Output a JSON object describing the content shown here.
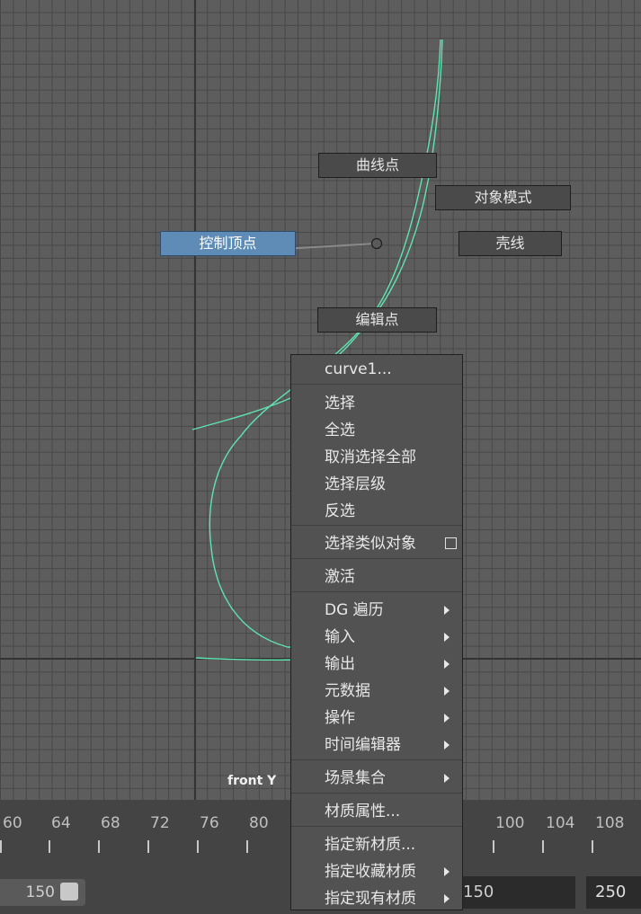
{
  "viewport": {
    "view_label": "front Y",
    "marking_menu": {
      "north": "曲线点",
      "northeast": "对象模式",
      "west": "控制顶点",
      "east": "壳线",
      "south": "编辑点"
    },
    "colors": {
      "background": "#5d5d5d",
      "grid": "#484848",
      "curve": "#5fe3b1",
      "active_item": "#5e8cb6"
    }
  },
  "timeline": {
    "ticks": [
      "60",
      "64",
      "68",
      "72",
      "76",
      "80",
      "100",
      "104",
      "108"
    ]
  },
  "range": {
    "end_value": "150",
    "end_field": "150",
    "max_field": "250"
  },
  "context_menu": {
    "title": "curve1...",
    "group1": [
      "选择",
      "全选",
      "取消选择全部",
      "选择层级",
      "反选"
    ],
    "select_similar": "选择类似对象",
    "activate": "激活",
    "submenus": [
      "DG 遍历",
      "输入",
      "输出",
      "元数据",
      "操作",
      "时间编辑器"
    ],
    "scene_sets": "场景集合",
    "material_attributes": "材质属性...",
    "materials": [
      "指定新材质...",
      "指定收藏材质",
      "指定现有材质"
    ]
  }
}
